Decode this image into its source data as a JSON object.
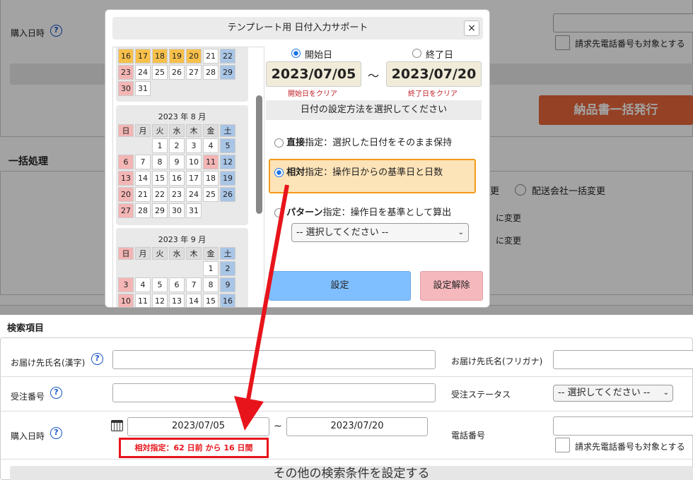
{
  "background": {
    "top_purchase_label": "購入日時",
    "top_chk_label": "請求先電話番号も対象とする",
    "bulk_issue_button": "納品書一括発行",
    "bulk_section_title": "一括処理",
    "bulk_radio_tail": "更",
    "bulk_radio_delivery": "配送会社一括変更",
    "change_to_1": "に変更",
    "change_to_2": "に変更"
  },
  "search": {
    "section_title": "検索項目",
    "recipient_name_label": "お届け先氏名(漢字)",
    "recipient_kana_label": "お届け先氏名(フリガナ)",
    "order_no_label": "受注番号",
    "order_status_label": "受注ステータス",
    "order_status_value": "-- 選択してください --",
    "purchase_date_label": "購入日時",
    "date_from": "2023/07/05",
    "tilde": "~",
    "date_to": "2023/07/20",
    "phone_label": "電話番号",
    "phone_chk_label": "請求先電話番号も対象とする",
    "relative_note": "相対指定：62 日前 から 16 日間",
    "more_conditions_button": "その他の検索条件を設定する"
  },
  "dialog": {
    "title": "テンプレート用 日付入力サポート",
    "close_label": "×",
    "start_radio_label": "開始日",
    "end_radio_label": "終了日",
    "start_date": "2023/07/05",
    "end_date": "2023/07/20",
    "range_sep": "～",
    "clear_start": "開始日をクリア",
    "clear_end": "終了日をクリア",
    "method_header": "日付の設定方法を選択してください",
    "direct_bold": "直接",
    "direct_rest": "指定：選択した日付をそのまま保持",
    "relative_bold": "相対",
    "relative_rest": "指定：操作日からの基準日と日数",
    "pattern_bold": "パターン",
    "pattern_rest": "指定：操作日を基準として算出",
    "pattern_select": "-- 選択してください --",
    "set_button": "設定",
    "unset_button": "設定解除",
    "weekdays": [
      "日",
      "月",
      "火",
      "水",
      "木",
      "金",
      "土"
    ],
    "july_rows": [
      [
        "16",
        "17",
        "18",
        "19",
        "20",
        "21",
        "22"
      ],
      [
        "23",
        "24",
        "25",
        "26",
        "27",
        "28",
        "29"
      ],
      [
        "30",
        "31",
        "",
        "",
        "",
        "",
        ""
      ]
    ],
    "aug_title": "2023 年 8 月",
    "aug_rows": [
      [
        "",
        "",
        "1",
        "2",
        "3",
        "4",
        "5"
      ],
      [
        "6",
        "7",
        "8",
        "9",
        "10",
        "11",
        "12"
      ],
      [
        "13",
        "14",
        "15",
        "16",
        "17",
        "18",
        "19"
      ],
      [
        "20",
        "21",
        "22",
        "23",
        "24",
        "25",
        "26"
      ],
      [
        "27",
        "28",
        "29",
        "30",
        "31",
        "",
        ""
      ]
    ],
    "sep_title": "2023 年 9 月",
    "sep_rows": [
      [
        "",
        "",
        "",
        "",
        "",
        "1",
        "2"
      ],
      [
        "3",
        "4",
        "5",
        "6",
        "7",
        "8",
        "9"
      ],
      [
        "10",
        "11",
        "12",
        "13",
        "14",
        "15",
        "16"
      ]
    ]
  },
  "colors": {
    "accent": "#1a73e8",
    "annotation_red": "#e8141b",
    "selected_day": "#f7c04a",
    "set_button": "#7fbfff",
    "unset_button": "#f5b8bd",
    "relative_highlight": "#fde3b8",
    "issue_button": "#e8663a"
  }
}
